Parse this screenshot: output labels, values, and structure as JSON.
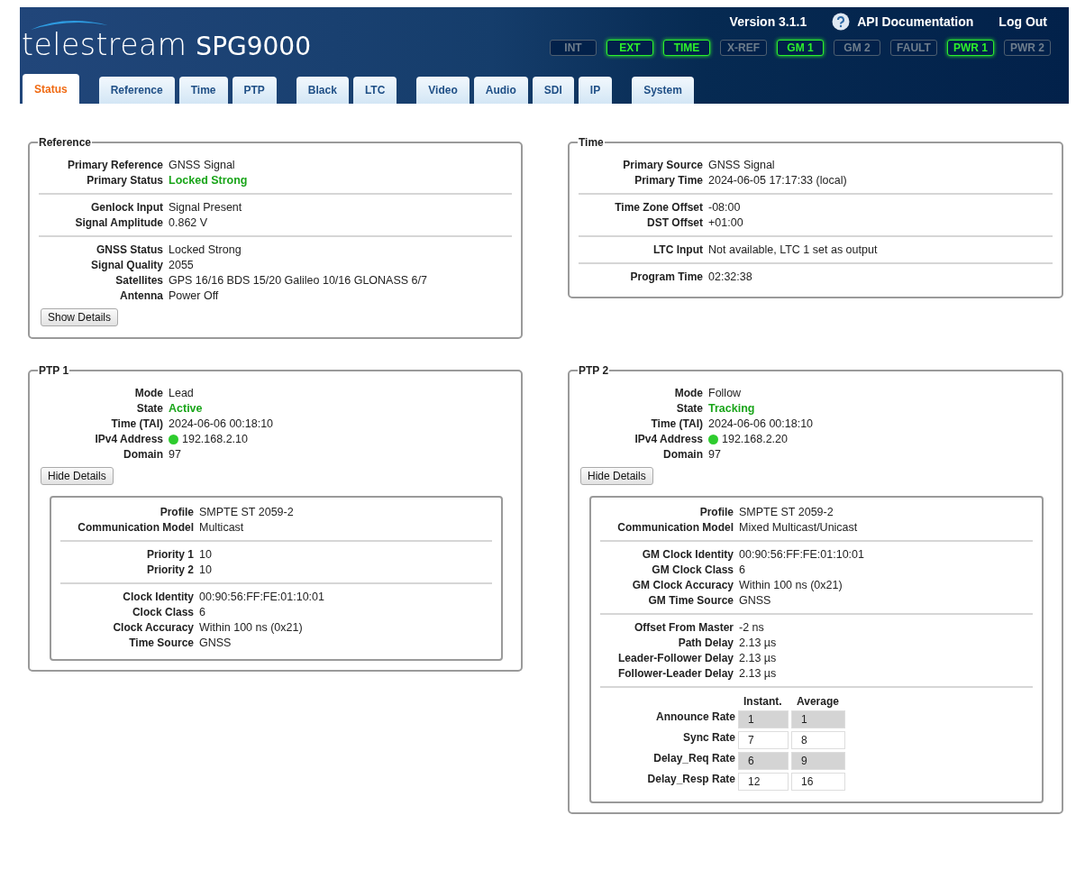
{
  "header": {
    "logo": "telestream",
    "product": "SPG9000",
    "version": "Version 3.1.1",
    "api_link": "API Documentation",
    "logout": "Log Out",
    "indicators": [
      {
        "label": "INT",
        "on": false
      },
      {
        "label": "EXT",
        "on": true
      },
      {
        "label": "TIME",
        "on": true
      },
      {
        "label": "X-REF",
        "on": false
      },
      {
        "label": "GM 1",
        "on": true
      },
      {
        "label": "GM 2",
        "on": false
      },
      {
        "label": "FAULT",
        "on": false
      },
      {
        "label": "PWR 1",
        "on": true
      },
      {
        "label": "PWR 2",
        "on": false
      }
    ],
    "tab_groups": [
      [
        {
          "label": "Status",
          "selected": true
        }
      ],
      [
        {
          "label": "Reference",
          "selected": false
        },
        {
          "label": "Time",
          "selected": false
        },
        {
          "label": "PTP",
          "selected": false
        }
      ],
      [
        {
          "label": "Black",
          "selected": false
        },
        {
          "label": "LTC",
          "selected": false
        }
      ],
      [
        {
          "label": "Video",
          "selected": false
        },
        {
          "label": "Audio",
          "selected": false
        },
        {
          "label": "SDI",
          "selected": false
        },
        {
          "label": "IP",
          "selected": false
        }
      ],
      [
        {
          "label": "System",
          "selected": false
        }
      ]
    ]
  },
  "panels": [
    {
      "title": "Reference",
      "sections": [
        [
          {
            "label": "Primary Reference",
            "value": "GNSS Signal"
          },
          {
            "label": "Primary Status",
            "value": "Locked Strong",
            "good": true
          }
        ],
        [
          {
            "label": "Genlock Input",
            "value": "Signal Present"
          },
          {
            "label": "Signal Amplitude",
            "value": "0.862 V"
          }
        ],
        [
          {
            "label": "GNSS Status",
            "value": "Locked Strong"
          },
          {
            "label": "Signal Quality",
            "value": "2055"
          },
          {
            "label": "Satellites",
            "value": "GPS 16/16 BDS 15/20 Galileo 10/16 GLONASS 6/7"
          },
          {
            "label": "Antenna",
            "value": "Power Off"
          }
        ]
      ],
      "button": "Show Details"
    },
    {
      "title": "Time",
      "sections": [
        [
          {
            "label": "Primary Source",
            "value": "GNSS Signal"
          },
          {
            "label": "Primary Time",
            "value": "2024-06-05 17:17:33 (local)"
          }
        ],
        [
          {
            "label": "Time Zone Offset",
            "value": "-08:00"
          },
          {
            "label": "DST Offset",
            "value": "+01:00"
          }
        ],
        [
          {
            "label": "LTC Input",
            "value": "Not available, LTC 1 set as output"
          }
        ],
        [
          {
            "label": "Program Time",
            "value": "02:32:38"
          }
        ]
      ]
    },
    {
      "title": "PTP 1",
      "sections": [
        [
          {
            "label": "Mode",
            "value": "Lead"
          },
          {
            "label": "State",
            "value": "Active",
            "good": true
          },
          {
            "label": "Time (TAI)",
            "value": "2024-06-06 00:18:10"
          },
          {
            "label": "IPv4 Address",
            "value": "192.168.2.10",
            "link_up": true
          },
          {
            "label": "Domain",
            "value": "97"
          }
        ]
      ],
      "button": "Hide Details",
      "details": {
        "sections": [
          [
            {
              "label": "Profile",
              "value": "SMPTE ST 2059-2"
            },
            {
              "label": "Communication Model",
              "value": "Multicast"
            }
          ],
          [
            {
              "label": "Priority 1",
              "value": "10"
            },
            {
              "label": "Priority 2",
              "value": "10"
            }
          ],
          [
            {
              "label": "Clock Identity",
              "value": "00:90:56:FF:FE:01:10:01"
            },
            {
              "label": "Clock Class",
              "value": "6"
            },
            {
              "label": "Clock Accuracy",
              "value": "Within 100 ns (0x21)"
            },
            {
              "label": "Time Source",
              "value": "GNSS"
            }
          ]
        ]
      }
    },
    {
      "title": "PTP 2",
      "sections": [
        [
          {
            "label": "Mode",
            "value": "Follow"
          },
          {
            "label": "State",
            "value": "Tracking",
            "good": true
          },
          {
            "label": "Time (TAI)",
            "value": "2024-06-06 00:18:10"
          },
          {
            "label": "IPv4 Address",
            "value": "192.168.2.20",
            "link_up": true
          },
          {
            "label": "Domain",
            "value": "97"
          }
        ]
      ],
      "button": "Hide Details",
      "details": {
        "sections": [
          [
            {
              "label": "Profile",
              "value": "SMPTE ST 2059-2"
            },
            {
              "label": "Communication Model",
              "value": "Mixed Multicast/Unicast"
            }
          ],
          [
            {
              "label": "GM Clock Identity",
              "value": "00:90:56:FF:FE:01:10:01"
            },
            {
              "label": "GM Clock Class",
              "value": "6"
            },
            {
              "label": "GM Clock Accuracy",
              "value": "Within 100 ns (0x21)"
            },
            {
              "label": "GM Time Source",
              "value": "GNSS"
            }
          ],
          [
            {
              "label": "Offset From Master",
              "value": "-2 ns"
            },
            {
              "label": "Path Delay",
              "value": "2.13 µs"
            },
            {
              "label": "Leader-Follower Delay",
              "value": "2.13 µs"
            },
            {
              "label": "Follower-Leader Delay",
              "value": "2.13 µs"
            }
          ]
        ],
        "rates": {
          "columns": [
            "Instant.",
            "Average"
          ],
          "rows": [
            {
              "label": "Announce Rate",
              "values": [
                "1",
                "1"
              ]
            },
            {
              "label": "Sync Rate",
              "values": [
                "7",
                "8"
              ]
            },
            {
              "label": "Delay_Req Rate",
              "values": [
                "6",
                "9"
              ]
            },
            {
              "label": "Delay_Resp Rate",
              "values": [
                "12",
                "16"
              ]
            }
          ]
        }
      }
    }
  ]
}
